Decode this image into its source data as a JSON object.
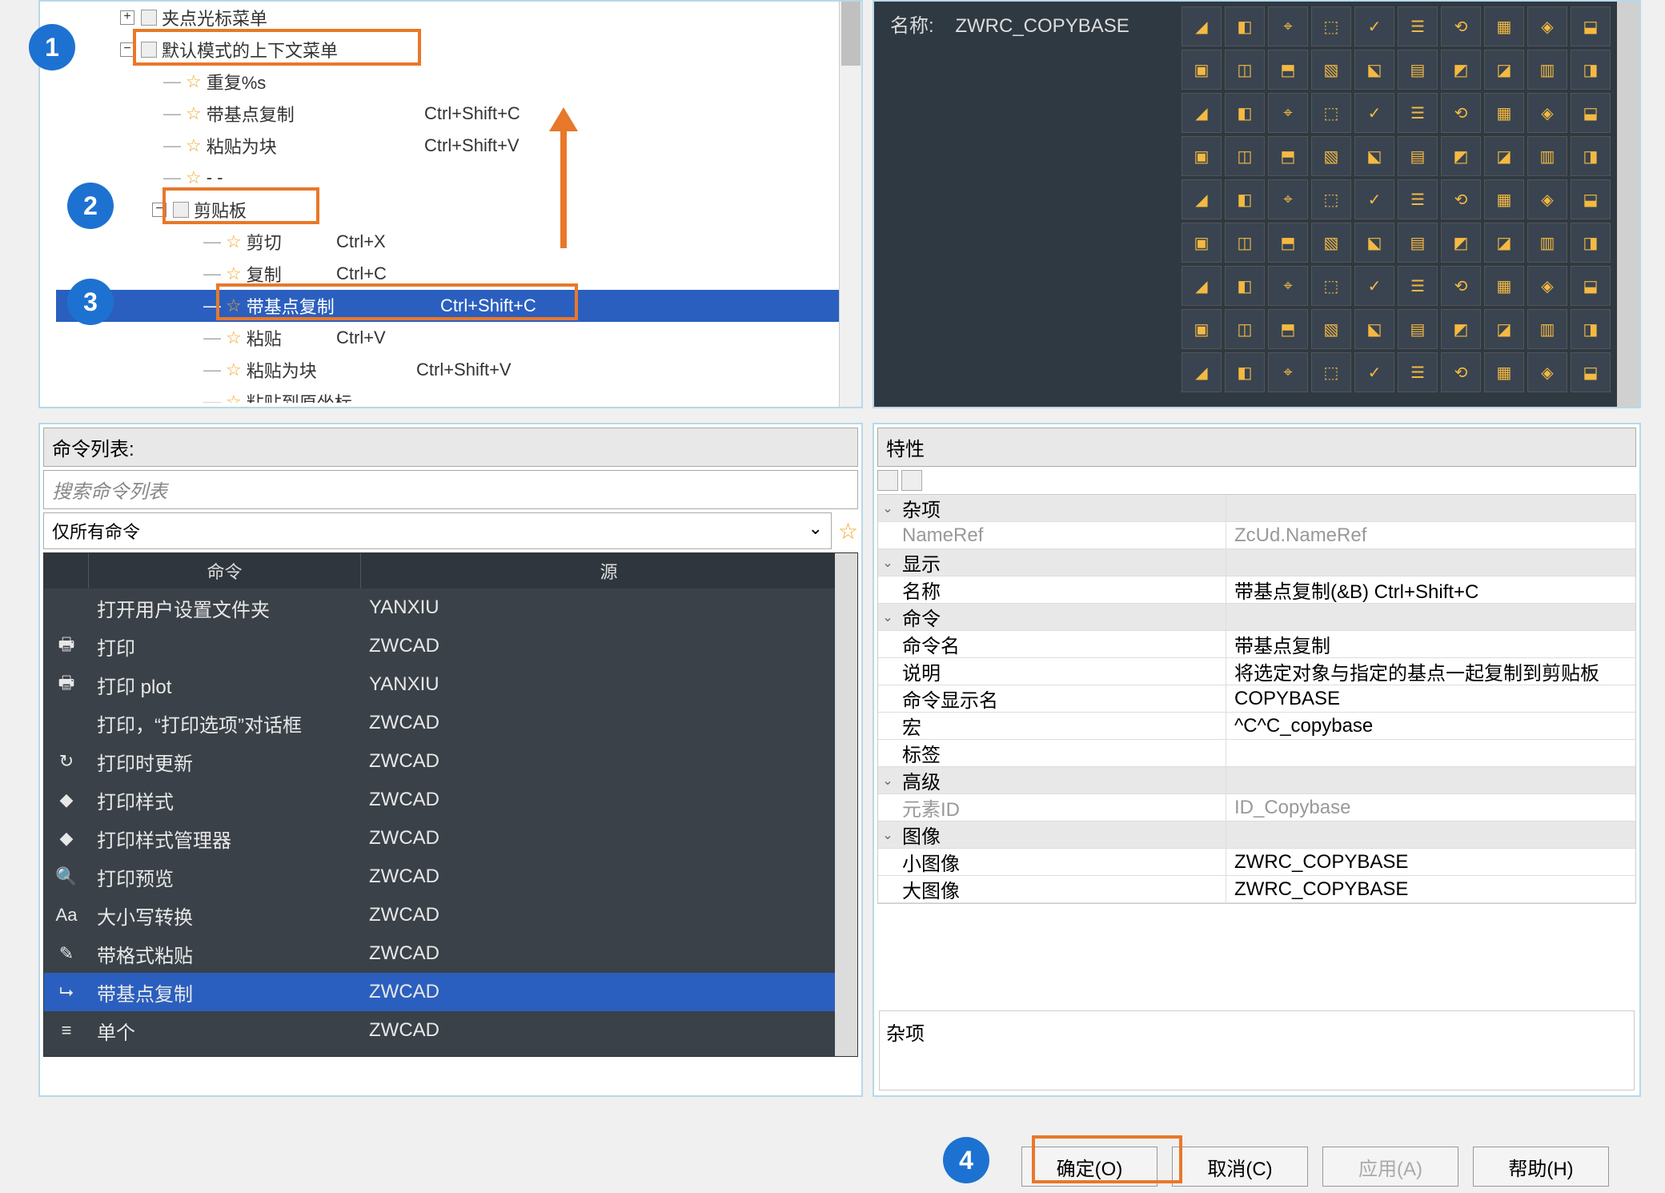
{
  "tree": {
    "n0": {
      "label": "夹点光标菜单"
    },
    "n1": {
      "label": "默认模式的上下文菜单"
    },
    "n1_children": [
      {
        "label": "重复%s",
        "kb": ""
      },
      {
        "label": "带基点复制",
        "kb": "Ctrl+Shift+C"
      },
      {
        "label": "粘贴为块",
        "kb": "Ctrl+Shift+V"
      },
      {
        "label": "- -",
        "kb": ""
      }
    ],
    "clipboard": {
      "label": "剪贴板"
    },
    "clip_children": [
      {
        "label": "剪切",
        "kb": "Ctrl+X"
      },
      {
        "label": "复制",
        "kb": "Ctrl+C"
      },
      {
        "label": "带基点复制",
        "kb": "Ctrl+Shift+C"
      },
      {
        "label": "粘贴",
        "kb": "Ctrl+V"
      },
      {
        "label": "粘贴为块",
        "kb": "Ctrl+Shift+V"
      },
      {
        "label": "粘贴到原坐标",
        "kb": ""
      }
    ]
  },
  "cmdlist": {
    "header": "命令列表:",
    "search_placeholder": "搜索命令列表",
    "filter": "仅所有命令",
    "cols": {
      "cmd": "命令",
      "src": "源"
    },
    "rows": [
      {
        "icon": "",
        "name": "打开用户设置文件夹",
        "src": "YANXIU"
      },
      {
        "icon": "🖶",
        "name": "打印",
        "src": "ZWCAD"
      },
      {
        "icon": "🖶",
        "name": "打印 plot",
        "src": "YANXIU"
      },
      {
        "icon": "",
        "name": "打印，“打印选项”对话框",
        "src": "ZWCAD"
      },
      {
        "icon": "↻",
        "name": "打印时更新",
        "src": "ZWCAD"
      },
      {
        "icon": "◆",
        "name": "打印样式",
        "src": "ZWCAD"
      },
      {
        "icon": "◆",
        "name": "打印样式管理器",
        "src": "ZWCAD"
      },
      {
        "icon": "🔍",
        "name": "打印预览",
        "src": "ZWCAD"
      },
      {
        "icon": "Aa",
        "name": "大小写转换",
        "src": "ZWCAD"
      },
      {
        "icon": "✎",
        "name": "带格式粘贴",
        "src": "ZWCAD"
      },
      {
        "icon": "⮡",
        "name": "带基点复制",
        "src": "ZWCAD",
        "sel": true
      },
      {
        "icon": "≡",
        "name": "单个",
        "src": "ZWCAD"
      }
    ]
  },
  "right_top": {
    "name_label": "名称:",
    "name_value": "ZWRC_COPYBASE"
  },
  "props": {
    "header": "特性",
    "cats": {
      "misc": "杂项",
      "nameref_l": "NameRef",
      "nameref_v": "ZcUd.NameRef",
      "disp": "显示",
      "name_l": "名称",
      "name_v": "带基点复制(&B)        Ctrl+Shift+C",
      "cmd": "命令",
      "cmdname_l": "命令名",
      "cmdname_v": "带基点复制",
      "desc_l": "说明",
      "desc_v": "将选定对象与指定的基点一起复制到剪贴板",
      "dispname_l": "命令显示名",
      "dispname_v": "COPYBASE",
      "macro_l": "宏",
      "macro_v": "^C^C_copybase",
      "tag_l": "标签",
      "tag_v": "",
      "adv": "高级",
      "elid_l": "元素ID",
      "elid_v": "ID_Copybase",
      "img": "图像",
      "smimg_l": "小图像",
      "smimg_v": "ZWRC_COPYBASE",
      "lgimg_l": "大图像",
      "lgimg_v": "ZWRC_COPYBASE"
    },
    "desc_title": "杂项"
  },
  "buttons": {
    "ok": "确定(O)",
    "cancel": "取消(C)",
    "apply": "应用(A)",
    "help": "帮助(H)"
  },
  "badges": {
    "b1": "1",
    "b2": "2",
    "b3": "3",
    "b4": "4"
  }
}
